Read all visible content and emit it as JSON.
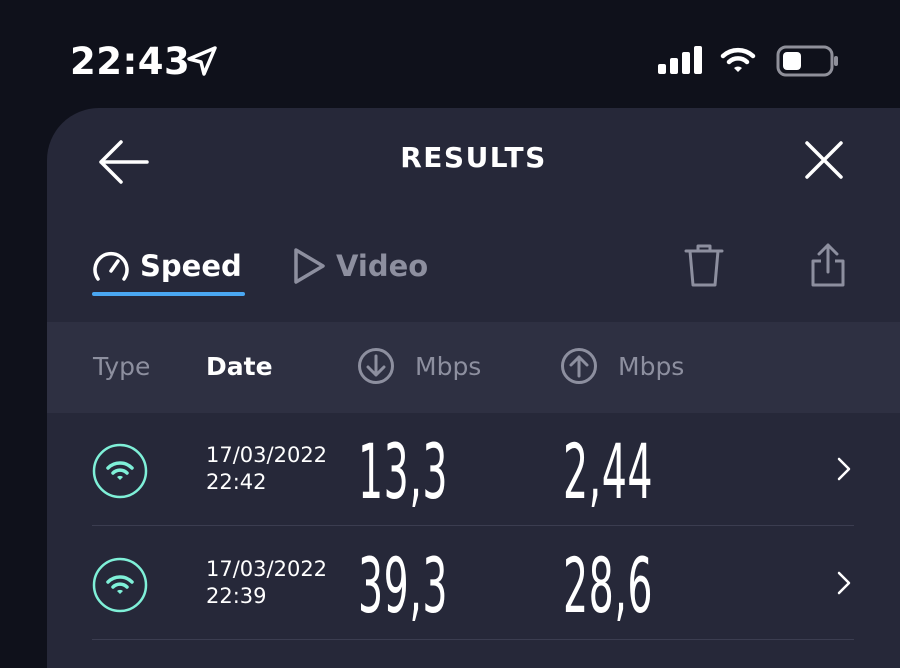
{
  "status_bar": {
    "time": "22:43"
  },
  "header": {
    "title": "RESULTS"
  },
  "tabs": [
    {
      "label": "Speed",
      "active": true,
      "icon": "speedometer-icon"
    },
    {
      "label": "Video",
      "active": false,
      "icon": "play-icon"
    }
  ],
  "table": {
    "columns": {
      "type": "Type",
      "date": "Date",
      "download": {
        "icon": "download-arrow-icon",
        "unit": "Mbps"
      },
      "upload": {
        "icon": "upload-arrow-icon",
        "unit": "Mbps"
      }
    },
    "rows": [
      {
        "type_icon": "wifi-icon",
        "date": "17/03/2022",
        "time": "22:42",
        "download": "13,3",
        "upload": "2,44"
      },
      {
        "type_icon": "wifi-icon",
        "date": "17/03/2022",
        "time": "22:39",
        "download": "39,3",
        "upload": "28,6"
      }
    ]
  },
  "colors": {
    "background": "#0f111b",
    "sheet": "#262839",
    "header_row": "#2e3042",
    "accent": "#4aa7f2",
    "wifi_teal": "#7ff0d8",
    "muted": "#8d8f9f"
  }
}
